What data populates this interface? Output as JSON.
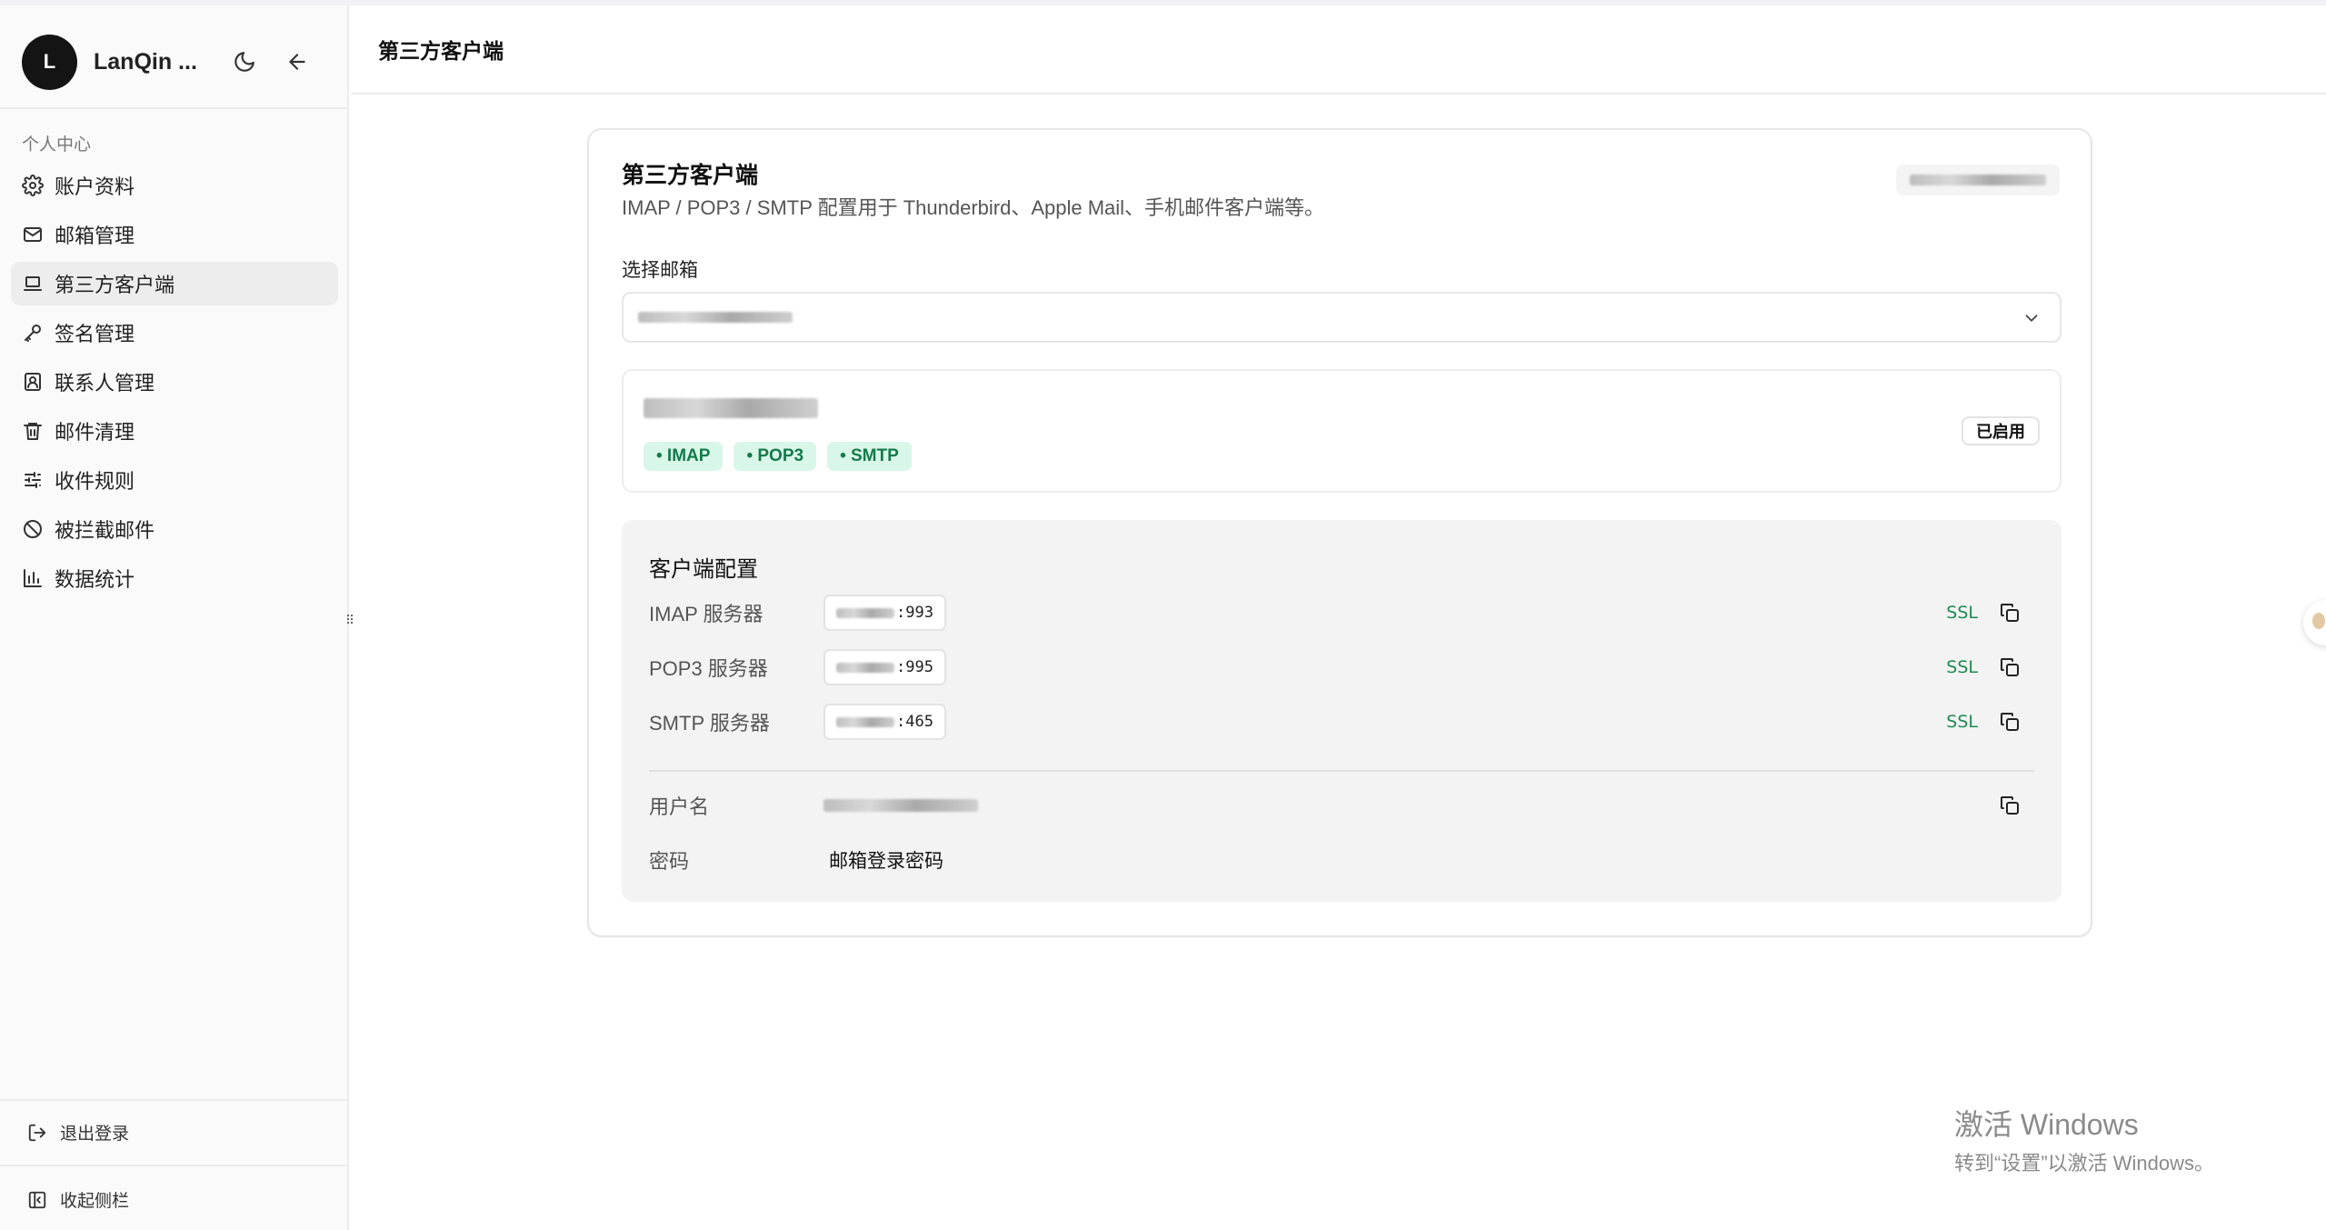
{
  "app": {
    "avatar_letter": "L",
    "name": "LanQin ..."
  },
  "sidebar": {
    "section_label": "个人中心",
    "items": [
      {
        "label": "账户资料",
        "icon": "gear-icon"
      },
      {
        "label": "邮箱管理",
        "icon": "mail-icon"
      },
      {
        "label": "第三方客户端",
        "icon": "laptop-icon",
        "active": true
      },
      {
        "label": "签名管理",
        "icon": "key-icon"
      },
      {
        "label": "联系人管理",
        "icon": "contact-icon"
      },
      {
        "label": "邮件清理",
        "icon": "trash-icon"
      },
      {
        "label": "收件规则",
        "icon": "sliders-icon"
      },
      {
        "label": "被拦截邮件",
        "icon": "ban-icon"
      },
      {
        "label": "数据统计",
        "icon": "bar-chart-icon"
      }
    ],
    "logout_label": "退出登录",
    "collapse_label": "收起侧栏"
  },
  "header": {
    "title": "第三方客户端"
  },
  "card": {
    "title": "第三方客户端",
    "description": "IMAP / POP3 / SMTP 配置用于 Thunderbird、Apple Mail、手机邮件客户端等。",
    "select_label": "选择邮箱",
    "mailbox": {
      "protocols": [
        "• IMAP",
        "• POP3",
        "• SMTP"
      ],
      "status": "已启用"
    },
    "config": {
      "title": "客户端配置",
      "servers": [
        {
          "label": "IMAP 服务器",
          "port_suffix": ":993",
          "security": "SSL"
        },
        {
          "label": "POP3 服务器",
          "port_suffix": ":995",
          "security": "SSL"
        },
        {
          "label": "SMTP 服务器",
          "port_suffix": ":465",
          "security": "SSL"
        }
      ],
      "username_label": "用户名",
      "password_label": "密码",
      "password_value": "邮箱登录密码"
    }
  },
  "watermark": {
    "line1": "激活 Windows",
    "line2": "转到“设置”以激活 Windows。"
  },
  "colors": {
    "accent_green": "#1e8a55",
    "badge_bg": "#d9f7e8",
    "sidebar_bg": "#fafafa",
    "panel_bg": "#f3f3f3"
  }
}
